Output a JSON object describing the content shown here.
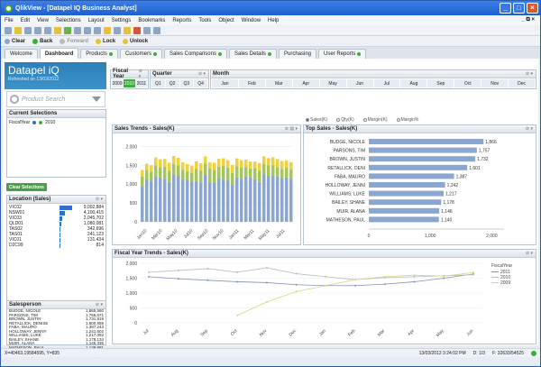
{
  "window": {
    "title": "QlikView - [Datapel IQ Business Analyst]",
    "min": "_",
    "max": "□",
    "close": "×"
  },
  "menu": [
    "File",
    "Edit",
    "View",
    "Selections",
    "Layout",
    "Settings",
    "Bookmarks",
    "Reports",
    "Tools",
    "Object",
    "Window",
    "Help"
  ],
  "menu_right": "_ ⧉ ×",
  "toolbar2": {
    "clear": "Clear",
    "back": "Back",
    "forward": "Forward",
    "lock": "Lock",
    "unlock": "Unlock"
  },
  "tabs": [
    {
      "label": "Welcome",
      "dot": false,
      "active": false
    },
    {
      "label": "Dashboard",
      "dot": false,
      "active": true
    },
    {
      "label": "Products",
      "dot": true,
      "active": false
    },
    {
      "label": "Customers",
      "dot": true,
      "active": false
    },
    {
      "label": "Sales Comparisons",
      "dot": true,
      "active": false
    },
    {
      "label": "Sales Details",
      "dot": true,
      "active": false
    },
    {
      "label": "Purchasing",
      "dot": false,
      "active": false
    },
    {
      "label": "User Reports",
      "dot": true,
      "active": false
    }
  ],
  "brand": {
    "title": "Datapel iQ",
    "refreshed": "Refreshed on 13/03/2012"
  },
  "product_search": {
    "placeholder": "Product Search"
  },
  "current_selections": {
    "title": "Current Selections",
    "field": "FiscalYear",
    "value": "2010"
  },
  "clear_selections": "Clear Selections",
  "location": {
    "title": "Location (Sales)",
    "rows": [
      {
        "name": "VIC02",
        "value": "9,002,884",
        "frac": 1.0
      },
      {
        "name": "NSW01",
        "value": "4,100,415",
        "frac": 0.46
      },
      {
        "name": "VIC03",
        "value": "2,045,702",
        "frac": 0.23
      },
      {
        "name": "QLD01",
        "value": "1,080,081",
        "frac": 0.12
      },
      {
        "name": "TAS02",
        "value": "342,696",
        "frac": 0.04
      },
      {
        "name": "TAS01",
        "value": "241,123",
        "frac": 0.03
      },
      {
        "name": "VIC01",
        "value": "131,434",
        "frac": 0.015
      },
      {
        "name": "D2C99",
        "value": "814",
        "frac": 0.0
      }
    ]
  },
  "salesperson": {
    "title": "Salesperson",
    "rows": [
      {
        "name": "BUDGE, NICOLE",
        "value": "1,865,560"
      },
      {
        "name": "PARSONS, TIM",
        "value": "1,756,671"
      },
      {
        "name": "BROWN, JUSTIN",
        "value": "1,731,919"
      },
      {
        "name": "RETALLICK, DENISE",
        "value": "1,600,655"
      },
      {
        "name": "FABA, MAURO",
        "value": "1,387,243"
      },
      {
        "name": "HOLLOWAY, JENNY",
        "value": "1,241,602"
      },
      {
        "name": "WILLIAMS, LUKE",
        "value": "1,217,092"
      },
      {
        "name": "BAILEY, SHANE",
        "value": "1,178,134"
      },
      {
        "name": "MUIR, ALANA",
        "value": "1,145,335"
      },
      {
        "name": "MATHESON, PAUL",
        "value": "1,139,991"
      },
      {
        "name": "GAMBLIDEN, TARIQ",
        "value": "1,130,698"
      },
      {
        "name": "STURGESS, CLEM",
        "value": "803,881"
      }
    ]
  },
  "fiscal_year": {
    "title": "Fiscal Year",
    "values": [
      "2009",
      "2010",
      "2011"
    ],
    "selected": "2010"
  },
  "quarter": {
    "title": "Quarter",
    "values": [
      "Q1",
      "Q2",
      "Q3",
      "Q4"
    ]
  },
  "month": {
    "title": "Month",
    "values": [
      "Jan",
      "Feb",
      "Mar",
      "Apr",
      "May",
      "Jun",
      "Jul",
      "Aug",
      "Sep",
      "Oct",
      "Nov",
      "Dec"
    ]
  },
  "measures": [
    "Sales(K)",
    "Qty(K)",
    "Margin(K)",
    "Margin%"
  ],
  "colors": {
    "blue": "#2f6fd0",
    "green": "#3cae3a",
    "bar_blue": "#8ba6cf",
    "bar_green": "#a6c65a",
    "bar_yellow": "#f1d23c",
    "line_2011": "#8390b8",
    "line_2010": "#b8bcc4",
    "line_2009": "#d6d87a"
  },
  "chart_data": [
    {
      "type": "bar",
      "title": "Sales Trends - Sales(K)",
      "categories": [
        "Jan10",
        "Mar10",
        "May10",
        "Jul10",
        "Sep10",
        "Nov10",
        "Jan11",
        "Mar11",
        "May11",
        "Jul11",
        "Sep11",
        "Nov11"
      ],
      "series": [
        {
          "name": "",
          "values": [
            1050,
            1200,
            1150,
            1100,
            1150,
            1020,
            1180,
            1100,
            1200,
            1150,
            1200,
            1250
          ]
        },
        {
          "name": "",
          "values": [
            250,
            300,
            280,
            260,
            300,
            350,
            320,
            300,
            260,
            280,
            270,
            250
          ]
        },
        {
          "name": "",
          "values": [
            180,
            200,
            220,
            180,
            200,
            180,
            200,
            220,
            180,
            210,
            200,
            190
          ]
        }
      ],
      "y_ticks": [
        "0",
        "500",
        "1,000",
        "1,500",
        "2,000"
      ],
      "ylim": [
        0,
        2200
      ],
      "x_ticks": [
        "Jan10",
        "Mar10",
        "May10",
        "Jul10",
        "Sep10",
        "Nov10",
        "Jan11",
        "Mar11",
        "May11",
        "Jul11"
      ]
    },
    {
      "type": "bar",
      "orientation": "horizontal",
      "title": "Top Sales - Sales(K)",
      "categories": [
        "BUDGE, NICOLE",
        "PARSONS, TIM",
        "BROWN, JUSTIN",
        "RETALLICK, DENI",
        "FABA, MAURO",
        "HOLLOWAY, JENNI",
        "WILLIAMS, LUKE",
        "BAILEY, SHANE",
        "MUIR, ALANA",
        "MATHESON, PAUL"
      ],
      "values": [
        1866,
        1757,
        1732,
        1601,
        1387,
        1242,
        1217,
        1178,
        1146,
        1140
      ],
      "labels": [
        "1,866",
        "1,757",
        "1,732",
        "1,601",
        "1,387",
        "1,242",
        "1,217",
        "1,178",
        "1,146",
        "1,140"
      ],
      "x_ticks": [
        "0",
        "1,000",
        "2,000"
      ],
      "xlim": [
        0,
        2200
      ]
    },
    {
      "type": "line",
      "title": "Fiscal Year Trends - Sales(K)",
      "categories": [
        "Jul",
        "Aug",
        "Sep",
        "Oct",
        "Nov",
        "Dec",
        "Jan",
        "Feb",
        "Mar",
        "Apr",
        "May",
        "Jun"
      ],
      "legend_title": "FiscalYear",
      "series": [
        {
          "name": "2011",
          "values": [
            1550,
            1480,
            1430,
            1380,
            1350,
            1280,
            1250,
            1250,
            1300,
            1380,
            1500,
            1640
          ]
        },
        {
          "name": "2010",
          "values": [
            1700,
            1760,
            1820,
            1700,
            1850,
            1650,
            1550,
            1450,
            1520,
            1550,
            1580,
            1620
          ]
        },
        {
          "name": "2009",
          "values": [
            null,
            null,
            null,
            250,
            700,
            1050,
            1250,
            1450,
            1550,
            1600,
            1570,
            1690
          ]
        }
      ],
      "y_ticks": [
        "0",
        "500",
        "1,000",
        "1,500",
        "2,000"
      ],
      "ylim": [
        0,
        2000
      ]
    }
  ],
  "status": {
    "left": "X=40463.19584595, Y=835",
    "date": "13/03/2012 3:24:02 PM",
    "page": "D: 1/3",
    "count": "F: 32633/54525"
  }
}
